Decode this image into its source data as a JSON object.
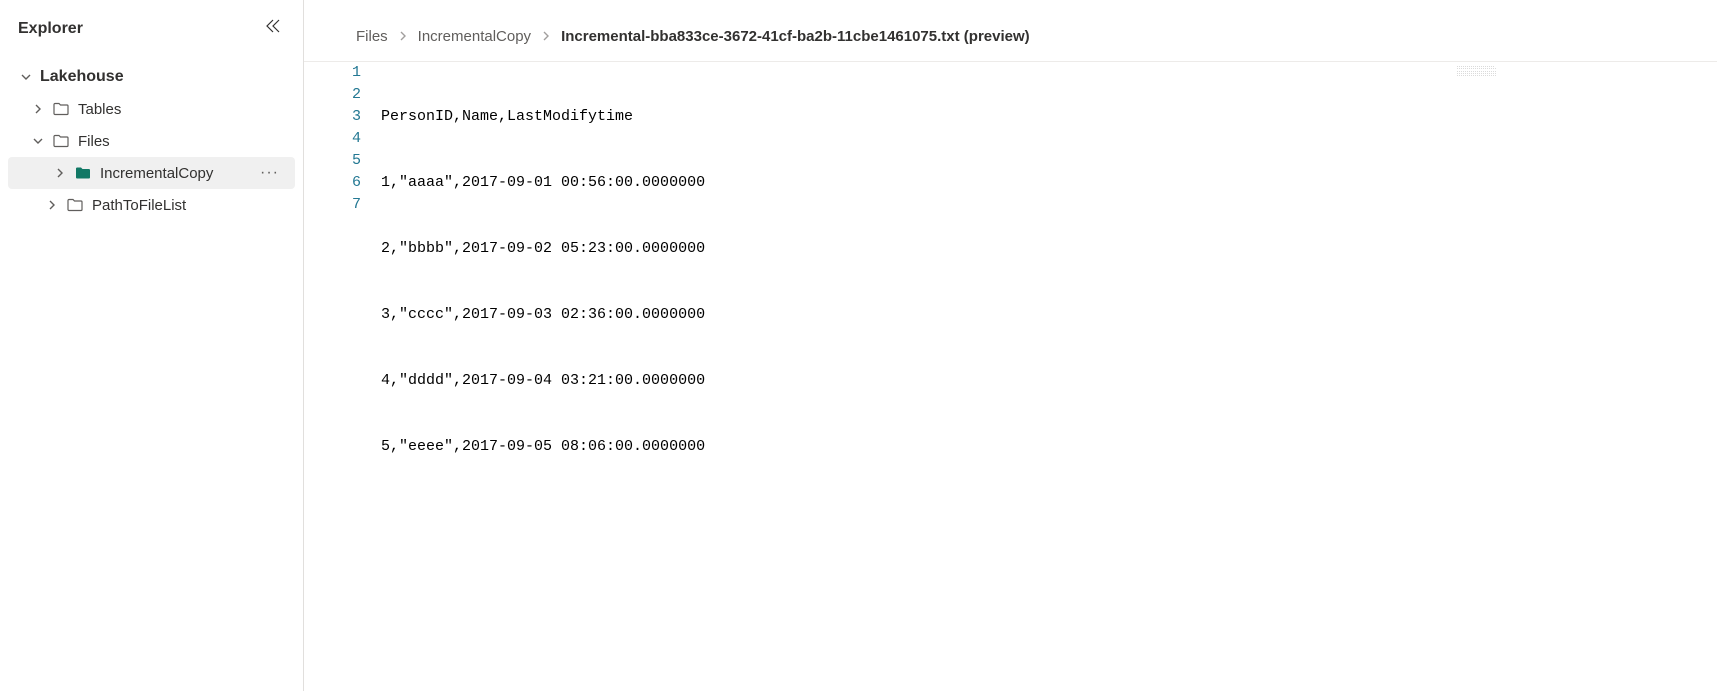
{
  "sidebar": {
    "title": "Explorer",
    "root": "Lakehouse",
    "items": [
      {
        "label": "Tables",
        "expanded": false
      },
      {
        "label": "Files",
        "expanded": true,
        "children": [
          {
            "label": "IncrementalCopy",
            "selected": true
          },
          {
            "label": "PathToFileList",
            "selected": false
          }
        ]
      }
    ]
  },
  "breadcrumb": {
    "items": [
      {
        "label": "Files"
      },
      {
        "label": "IncrementalCopy"
      },
      {
        "label": "Incremental-bba833ce-3672-41cf-ba2b-11cbe1461075.txt (preview)",
        "current": true
      }
    ]
  },
  "editor": {
    "lines": [
      "PersonID,Name,LastModifytime",
      "1,\"aaaa\",2017-09-01 00:56:00.0000000",
      "2,\"bbbb\",2017-09-02 05:23:00.0000000",
      "3,\"cccc\",2017-09-03 02:36:00.0000000",
      "4,\"dddd\",2017-09-04 03:21:00.0000000",
      "5,\"eeee\",2017-09-05 08:06:00.0000000",
      ""
    ],
    "lineNumbers": [
      "1",
      "2",
      "3",
      "4",
      "5",
      "6",
      "7"
    ]
  }
}
